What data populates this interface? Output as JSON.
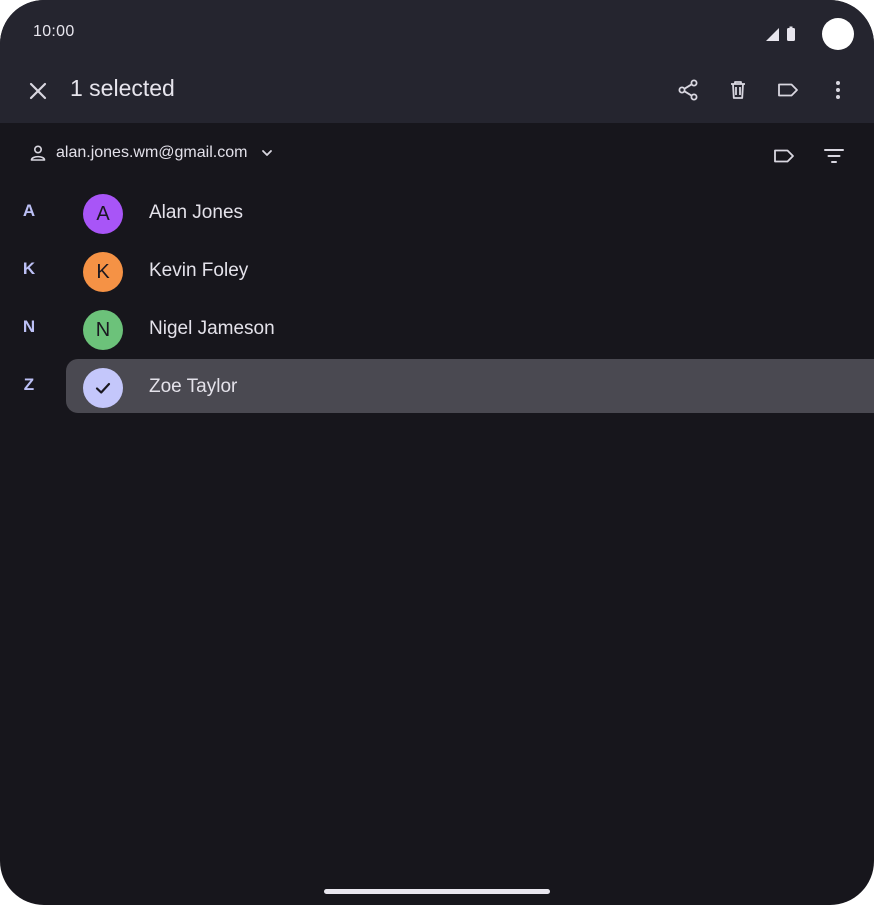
{
  "status_bar": {
    "time": "10:00"
  },
  "app_bar": {
    "title": "1 selected",
    "actions": [
      "share-icon",
      "delete-icon",
      "label-icon",
      "more-vert-icon"
    ]
  },
  "account": {
    "email": "alan.jones.wm@gmail.com"
  },
  "contacts": [
    {
      "letter": "A",
      "initial": "A",
      "name": "Alan Jones",
      "color": "#a855f7",
      "selected": false
    },
    {
      "letter": "K",
      "initial": "K",
      "name": "Kevin Foley",
      "color": "#f59245",
      "selected": false
    },
    {
      "letter": "N",
      "initial": "N",
      "name": "Nigel Jameson",
      "color": "#6cc27a",
      "selected": false
    },
    {
      "letter": "Z",
      "initial": "",
      "name": "Zoe Taylor",
      "color": "#c4c7fb",
      "selected": true
    }
  ],
  "colors": {
    "background": "#17161c",
    "app_bar": "#25252f",
    "selected_row": "#4a4951",
    "section_letter": "#bcc0f5"
  }
}
